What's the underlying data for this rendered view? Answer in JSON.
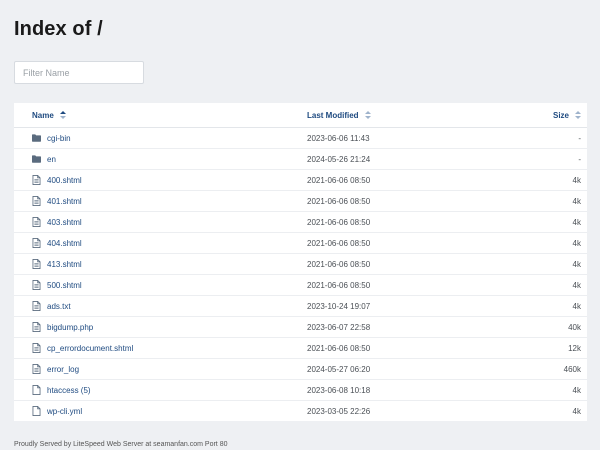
{
  "page": {
    "title": "Index of /"
  },
  "filter": {
    "placeholder": "Filter Name"
  },
  "table": {
    "headers": {
      "name": "Name",
      "modified": "Last Modified",
      "size": "Size"
    },
    "rows": [
      {
        "name": "cgi-bin",
        "modified": "2023-06-06 11:43",
        "size": "-",
        "type": "folder"
      },
      {
        "name": "en",
        "modified": "2024-05-26 21:24",
        "size": "-",
        "type": "folder"
      },
      {
        "name": "400.shtml",
        "modified": "2021-06-06 08:50",
        "size": "4k",
        "type": "document"
      },
      {
        "name": "401.shtml",
        "modified": "2021-06-06 08:50",
        "size": "4k",
        "type": "document"
      },
      {
        "name": "403.shtml",
        "modified": "2021-06-06 08:50",
        "size": "4k",
        "type": "document"
      },
      {
        "name": "404.shtml",
        "modified": "2021-06-06 08:50",
        "size": "4k",
        "type": "document"
      },
      {
        "name": "413.shtml",
        "modified": "2021-06-06 08:50",
        "size": "4k",
        "type": "document"
      },
      {
        "name": "500.shtml",
        "modified": "2021-06-06 08:50",
        "size": "4k",
        "type": "document"
      },
      {
        "name": "ads.txt",
        "modified": "2023-10-24 19:07",
        "size": "4k",
        "type": "document"
      },
      {
        "name": "bigdump.php",
        "modified": "2023-06-07 22:58",
        "size": "40k",
        "type": "document"
      },
      {
        "name": "cp_errordocument.shtml",
        "modified": "2021-06-06 08:50",
        "size": "12k",
        "type": "document"
      },
      {
        "name": "error_log",
        "modified": "2024-05-27 06:20",
        "size": "460k",
        "type": "document"
      },
      {
        "name": "htaccess (5)",
        "modified": "2023-06-08 10:18",
        "size": "4k",
        "type": "file"
      },
      {
        "name": "wp-cli.yml",
        "modified": "2023-03-05 22:26",
        "size": "4k",
        "type": "file"
      }
    ]
  },
  "footer": {
    "text": "Proudly Served by LiteSpeed Web Server at seamanfan.com Port 80"
  },
  "colors": {
    "link": "#1e4a80",
    "background": "#eef0f3",
    "panel": "#ffffff"
  }
}
